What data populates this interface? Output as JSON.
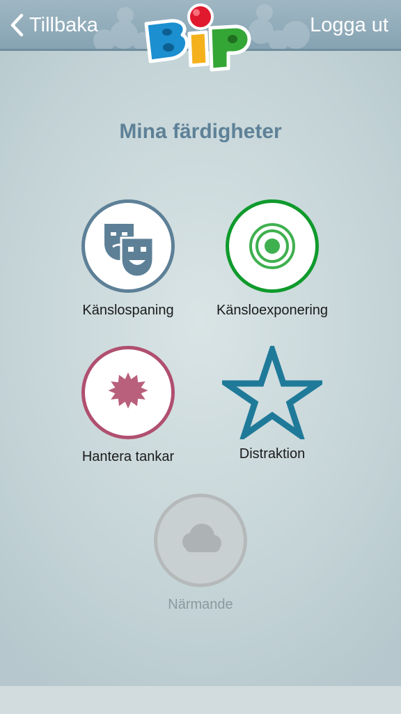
{
  "header": {
    "back_label": "Tillbaka",
    "logout_label": "Logga ut",
    "logo_text": "BiP"
  },
  "page": {
    "title": "Mina färdigheter"
  },
  "skills": [
    {
      "label": "Känslospaning",
      "icon": "masks-icon",
      "color": "#5d8097",
      "locked": false
    },
    {
      "label": "Känsloexponering",
      "icon": "target-icon",
      "color": "#0f9a2c",
      "locked": false
    },
    {
      "label": "Hantera tankar",
      "icon": "starburst-icon",
      "color": "#b04f6f",
      "locked": false
    },
    {
      "label": "Distraktion",
      "icon": "star-icon",
      "color": "#1f7a99",
      "locked": false
    },
    {
      "label": "Närmande",
      "icon": "cloud-icon",
      "color": "#b5b9ba",
      "locked": true
    }
  ]
}
